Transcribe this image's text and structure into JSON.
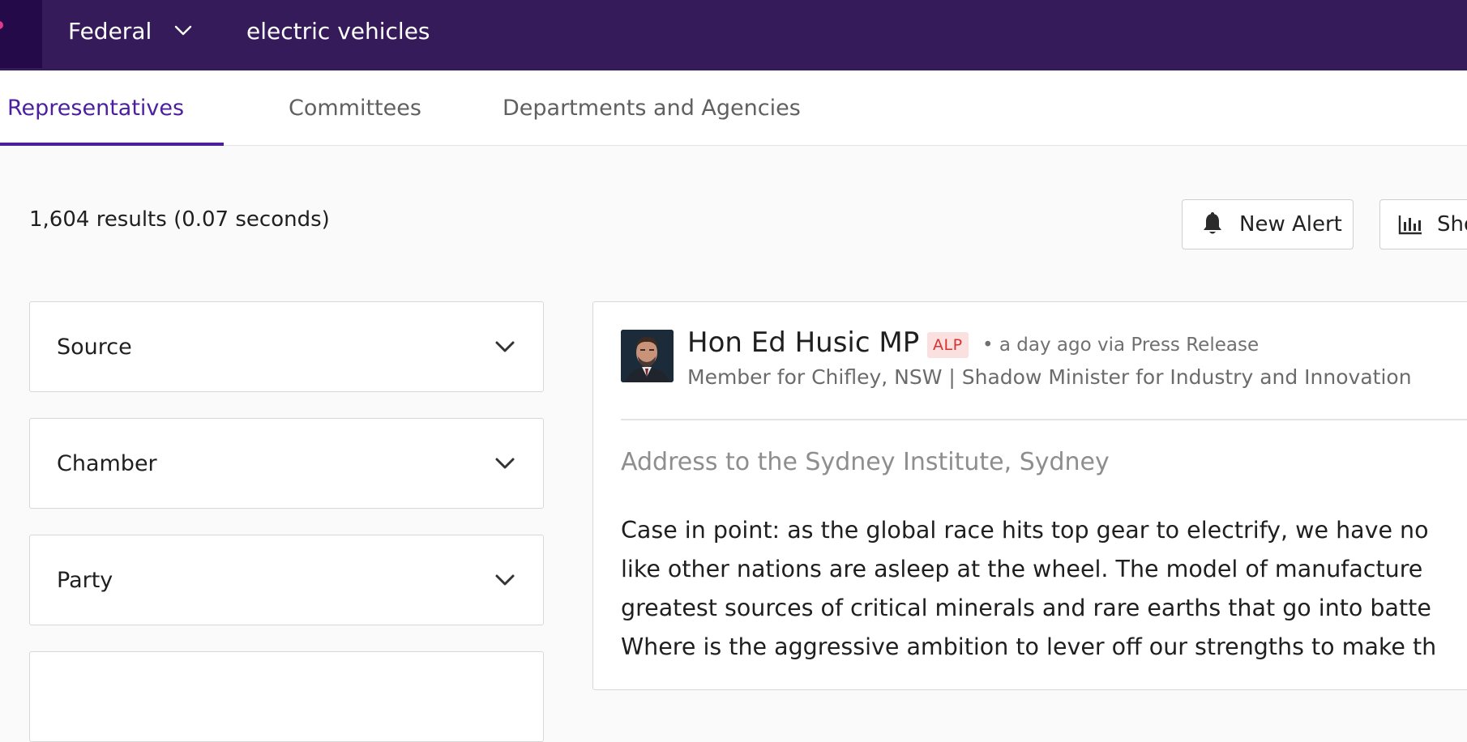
{
  "header": {
    "jurisdiction": "Federal",
    "search_query": "electric vehicles",
    "logo_icon": "app-logo-icon",
    "jurisdiction_icon": "chevron-down-icon"
  },
  "tabs": [
    {
      "label": "Representatives",
      "active": true
    },
    {
      "label": "Committees",
      "active": false
    },
    {
      "label": "Departments and Agencies",
      "active": false
    }
  ],
  "results": {
    "count_text": "1,604 results (0.07 seconds)"
  },
  "actions": {
    "new_alert_label": "New Alert",
    "new_alert_icon": "bell-icon",
    "show_label": "Sho",
    "show_icon": "bar-chart-icon"
  },
  "filters": [
    {
      "label": "Source"
    },
    {
      "label": "Chamber"
    },
    {
      "label": "Party"
    }
  ],
  "result_card": {
    "name": "Hon Ed Husic MP",
    "party": "ALP",
    "meta": "• a day ago via Press Release",
    "role": "Member for Chifley, NSW | Shadow Minister for Industry and Innovation",
    "title": "Address to the Sydney Institute, Sydney",
    "excerpt_lines": [
      "Case in point: as the global race hits top gear to electrify, we have no",
      "like other nations are asleep at the wheel. The model of manufacture",
      "greatest sources of critical minerals and rare earths that go into batte",
      "Where is the aggressive ambition to lever off our strengths to make th"
    ]
  },
  "colors": {
    "topbar": "#361b5b",
    "accent": "#4b1f9e",
    "party_badge_bg": "#fbe0e0",
    "party_badge_text": "#d53232"
  }
}
